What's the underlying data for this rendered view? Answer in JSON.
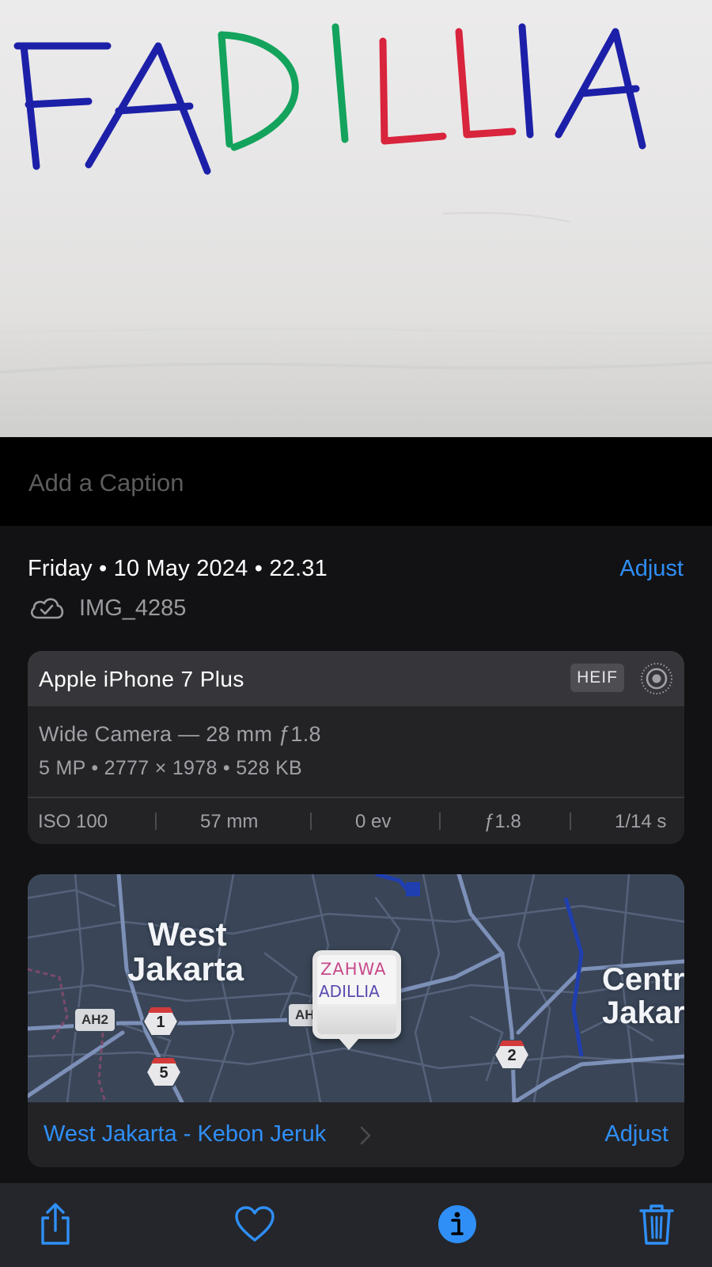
{
  "photo": {
    "handwriting_top": "FADILLIA",
    "colors": {
      "blue": "#1c20a8",
      "green": "#13a35c",
      "red": "#d8243c",
      "paper": "#e9e8e7"
    }
  },
  "caption": {
    "placeholder": "Add a Caption"
  },
  "info": {
    "date_line": "Friday • 10 May 2024 • 22.31",
    "adjust_label": "Adjust",
    "file_name": "IMG_4285",
    "camera": {
      "model": "Apple iPhone 7 Plus",
      "format_badge": "HEIF",
      "lens": "Wide Camera — 28 mm ƒ1.8",
      "specs": "5 MP  •  2777 × 1978  •  528 KB",
      "exif": {
        "iso": "ISO 100",
        "focal": "57 mm",
        "ev": "0 ev",
        "aperture": "ƒ1.8",
        "shutter": "1/14 s"
      }
    },
    "map": {
      "label_west_line1": "West",
      "label_west_line2": "Jakarta",
      "label_central_line1": "Centr",
      "label_central_line2": "Jakar",
      "route_ah2": "AH2",
      "route_ah_partial": "AH",
      "road_1": "1",
      "road_5": "5",
      "road_2": "2",
      "pin_text_line1": "ZAHWA",
      "pin_text_line2": "ADILLIA"
    },
    "location": {
      "name": "West Jakarta - Kebon Jeruk",
      "adjust_label": "Adjust"
    }
  },
  "toolbar": {
    "icons": [
      "share-icon",
      "heart-icon",
      "info-icon",
      "trash-icon"
    ],
    "accent": "#2f8ff7"
  }
}
